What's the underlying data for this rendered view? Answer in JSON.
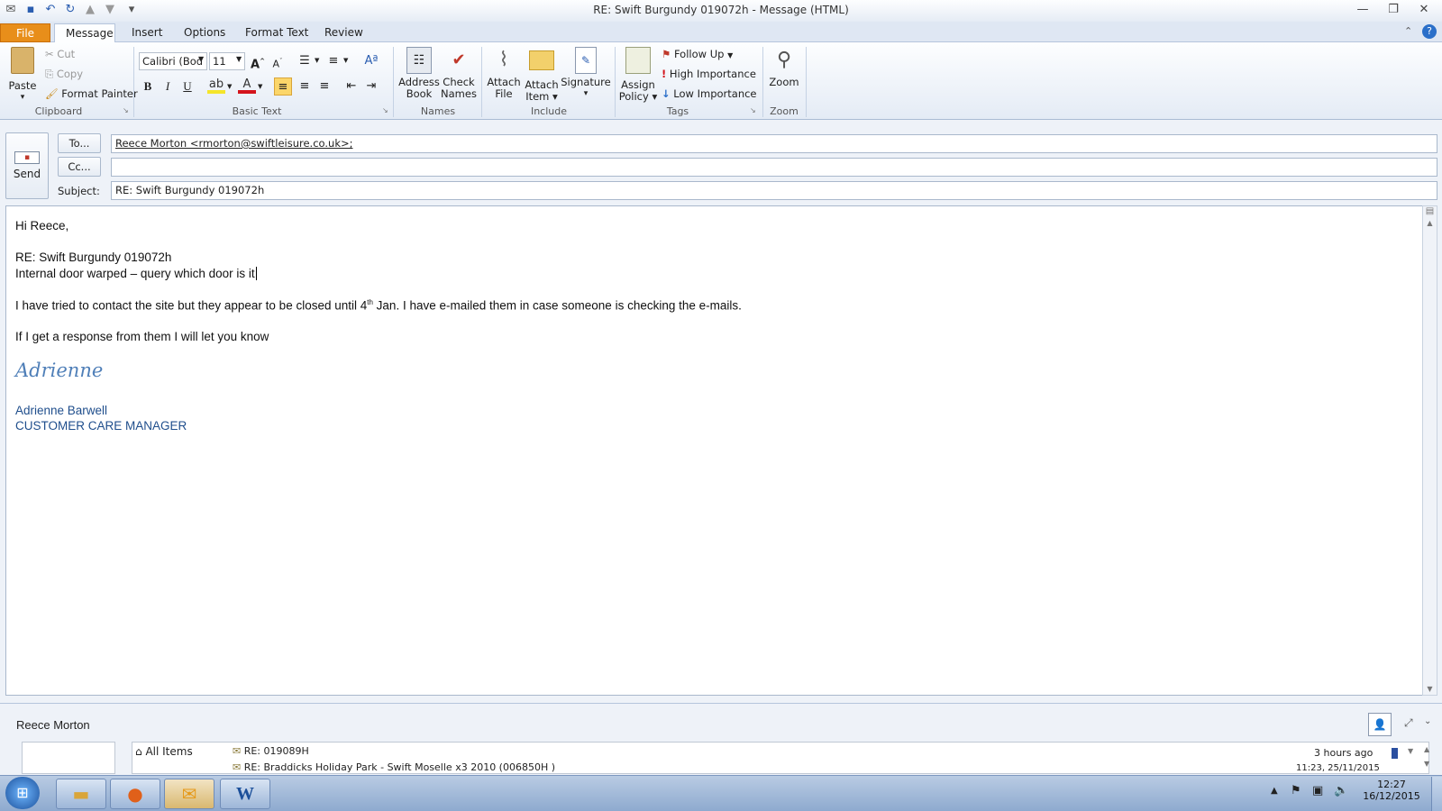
{
  "window": {
    "title": "RE: Swift Burgundy 019072h  -  Message (HTML)"
  },
  "tabs": [
    {
      "label": "File"
    },
    {
      "label": "Message"
    },
    {
      "label": "Insert"
    },
    {
      "label": "Options"
    },
    {
      "label": "Format Text"
    },
    {
      "label": "Review"
    }
  ],
  "ribbon": {
    "clipboard": {
      "paste": "Paste",
      "cut": "Cut",
      "copy": "Copy",
      "format_painter": "Format Painter",
      "label": "Clipboard"
    },
    "basic_text": {
      "font": "Calibri (Body)",
      "font_display": "Calibri (Bod",
      "size": "11",
      "label": "Basic Text"
    },
    "names": {
      "address_book": [
        "Address",
        "Book"
      ],
      "check_names": [
        "Check",
        "Names"
      ],
      "label": "Names"
    },
    "include": {
      "attach_file": [
        "Attach",
        "File"
      ],
      "attach_item": [
        "Attach",
        "Item"
      ],
      "signature": "Signature",
      "label": "Include"
    },
    "tags": {
      "assign_policy": [
        "Assign",
        "Policy"
      ],
      "follow_up": "Follow Up",
      "high_importance": "High Importance",
      "low_importance": "Low Importance",
      "label": "Tags"
    },
    "zoom": {
      "zoom": "Zoom",
      "label": "Zoom"
    }
  },
  "header": {
    "send": "Send",
    "to_button": "To...",
    "cc_button": "Cc...",
    "subject_label": "Subject:",
    "to_value": "Reece Morton <rmorton@swiftleisure.co.uk>;",
    "cc_value": "",
    "subject_value": "RE: Swift Burgundy 019072h"
  },
  "body": {
    "greeting": "Hi Reece,",
    "ref_line": "RE: Swift Burgundy 019072h",
    "issue_line": "Internal door warped – query which door is it",
    "para1_a": "I have tried to contact the site but they appear to be closed until 4",
    "para1_sup": "th",
    "para1_b": " Jan.  I have e-mailed them in case someone is checking the e-mails.",
    "para2": "If I get a response from them I will let you know",
    "signature_script": "Adrienne",
    "sig_name": "Adrienne Barwell",
    "sig_title": "CUSTOMER CARE MANAGER"
  },
  "people_pane": {
    "contact_name": "Reece Morton",
    "all_items": "All Items",
    "item1_subject": "RE: 019089H",
    "item1_time": "3 hours ago",
    "item2_subject": "RE: Braddicks Holiday Park - Swift Moselle x3 2010 (006850H )",
    "item2_time": "11:23, 25/11/2015"
  },
  "taskbar": {
    "time": "12:27",
    "date": "16/12/2015"
  },
  "colors": {
    "file_tab": "#e88e1a",
    "signature_blue": "#1f4e8c"
  }
}
